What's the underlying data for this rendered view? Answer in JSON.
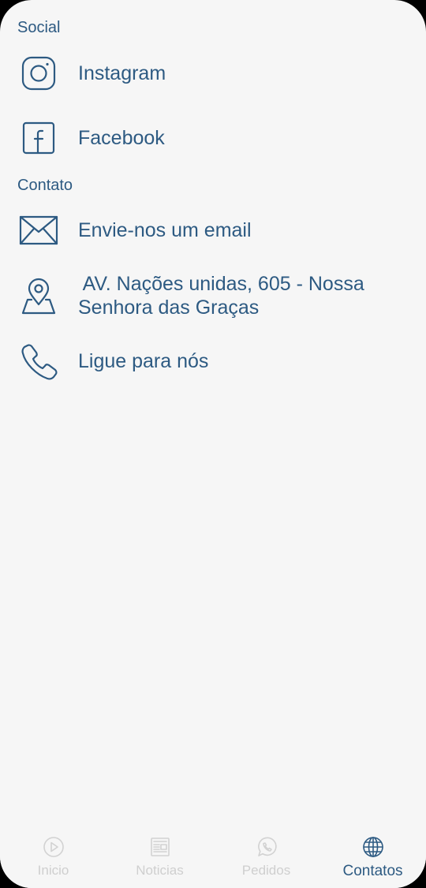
{
  "colors": {
    "accent": "#2d5a82",
    "background": "#f6f6f6",
    "inactive": "#cfcfcf"
  },
  "sections": {
    "social_title": "Social",
    "contato_title": "Contato"
  },
  "social": [
    {
      "icon": "instagram-icon",
      "label": "Instagram"
    },
    {
      "icon": "facebook-icon",
      "label": "Facebook"
    }
  ],
  "contato": {
    "email": {
      "icon": "envelope-icon",
      "label": "Envie-nos um email"
    },
    "address": {
      "icon": "map-pin-icon",
      "line1": " AV. Nações unidas, 605 - Nossa",
      "line2": "Senhora das Graças"
    },
    "phone": {
      "icon": "phone-icon",
      "label": "Ligue para nós"
    }
  },
  "bottom_nav": [
    {
      "icon": "play-circle-icon",
      "label": "Inicio",
      "active": false
    },
    {
      "icon": "newspaper-icon",
      "label": "Noticias",
      "active": false
    },
    {
      "icon": "whatsapp-icon",
      "label": "Pedidos",
      "active": false
    },
    {
      "icon": "globe-icon",
      "label": "Contatos",
      "active": true
    }
  ]
}
